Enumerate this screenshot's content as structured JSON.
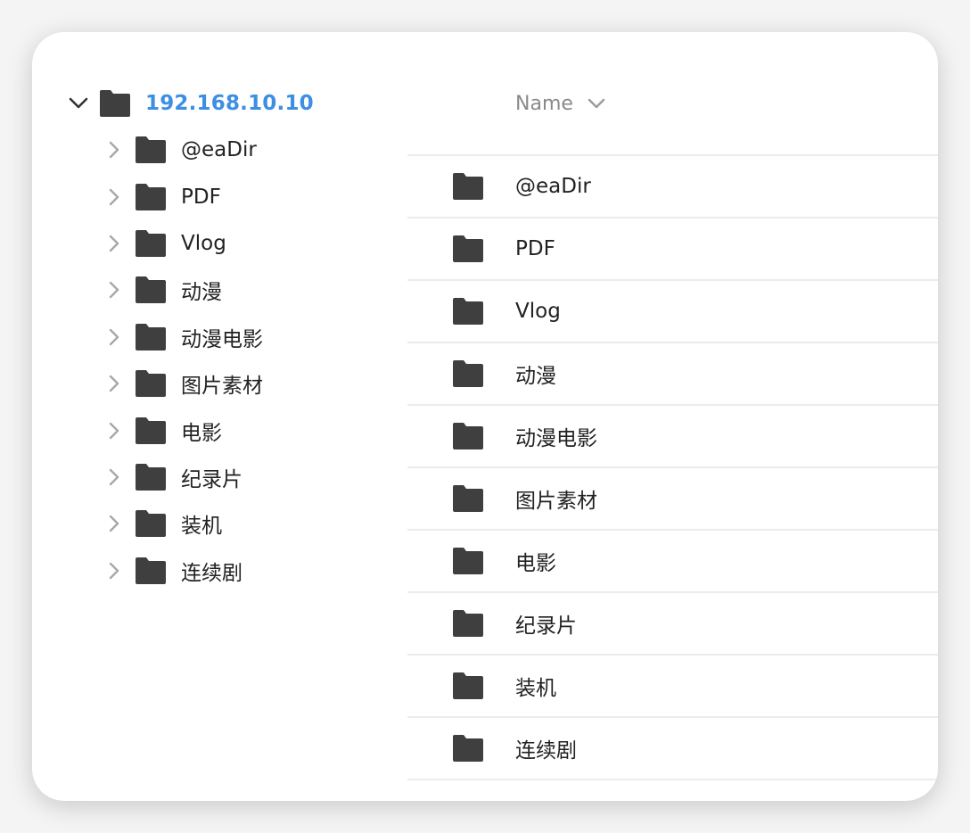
{
  "colors": {
    "accent": "#3d8fe3",
    "folder": "#3f3f3f",
    "chevron_collapsed": "#a8a8a8",
    "chevron_expanded": "#333333"
  },
  "tree": {
    "root": {
      "label": "192.168.10.10",
      "icon": "folder-icon",
      "expanded": true
    },
    "children": [
      {
        "label": "@eaDir"
      },
      {
        "label": "PDF"
      },
      {
        "label": "Vlog"
      },
      {
        "label": "动漫"
      },
      {
        "label": "动漫电影"
      },
      {
        "label": "图片素材"
      },
      {
        "label": "电影"
      },
      {
        "label": "纪录片"
      },
      {
        "label": "装机"
      },
      {
        "label": "连续剧"
      }
    ]
  },
  "list": {
    "header": {
      "name_label": "Name",
      "sort_icon": "chevron-down-icon"
    },
    "rows": [
      {
        "name": "@eaDir"
      },
      {
        "name": "PDF"
      },
      {
        "name": "Vlog"
      },
      {
        "name": "动漫"
      },
      {
        "name": "动漫电影"
      },
      {
        "name": "图片素材"
      },
      {
        "name": "电影"
      },
      {
        "name": "纪录片"
      },
      {
        "name": "装机"
      },
      {
        "name": "连续剧"
      }
    ]
  }
}
